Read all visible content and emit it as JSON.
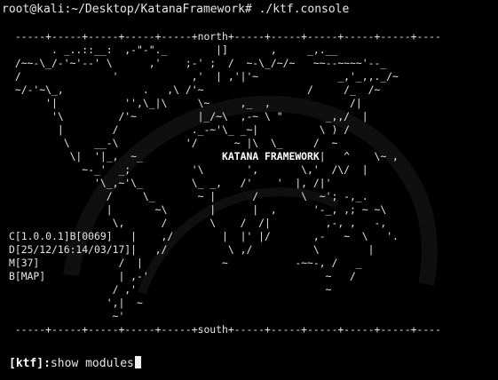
{
  "terminal": {
    "prompt": "root@kali:~/Desktop/KatanaFramework# ./ktf.console",
    "art_lines": [
      " -----+-----+-----+-----+-----+north+-----+-----+-----+-----+-----+----",
      "       . _..::__:  ,-\"-\"._        |]       ,     _,.__",
      " /~~-\\_/-'~'--' \\      ,'    ;-' ;  /  ~-\\_/~/~   ~~--~~~~'--_",
      " /               '            ,'  | ,'|'~             _,'_,,._/~",
      " ~/-'~\\_,             .   ,\\ /'~                 /     /_  /~",
      "      '|           '',\\_|\\     \\~     ,_  ,             /|",
      "       '\\         /'~          |_/~\\  ,-~ \\ \"       _,,/  |",
      "        |        /            ._-~'\\_ _~|          \\ ) /",
      "         \\    __-\\           '/      ~ |\\  \\_     /  ~",
      "          \\|  '|_,  ~_             ___KATANA_FRAMEWORK___|   ^    \\~ ,",
      "            ~-_'  _;          '\\       ',       \\,'  /\\/  |",
      "              '\\_,~'\\_        \\_ _,   /'    '  |, /|'",
      "                /     \\_       ~ |      /       \\  ~'; -,_.",
      "                |       ~\\       |      |  ,      '-_, ,; ~ ~\\",
      "                 \\,      /       \\    /  /|         ,-, ,   -,",
      "                  |    ,/        |  |' |/       ,-   ~  \\   '.",
      "                  |   ,/          \\ ,/          \\        |",
      "                  /  |             ~           -~~-, /   _",
      "                  | ,-'                             ~   /",
      "                 / ,'                               ~",
      "                ',|  ~",
      "                 ~'",
      " -----+-----+-----+-----+-----+south+-----+-----+-----+-----+-----+----"
    ],
    "stats": [
      {
        "key": "C",
        "value": "[1.0.0.1]B[0069]"
      },
      {
        "key": "D",
        "value": "[25/12/16:14/03/17]"
      },
      {
        "key": "M",
        "value": "[37]"
      },
      {
        "key": "B",
        "value": "[MAP]"
      }
    ],
    "banner": "KATANA FRAMEWORK",
    "shell_tag": "[ktf]:",
    "shell_command": "show modules"
  }
}
